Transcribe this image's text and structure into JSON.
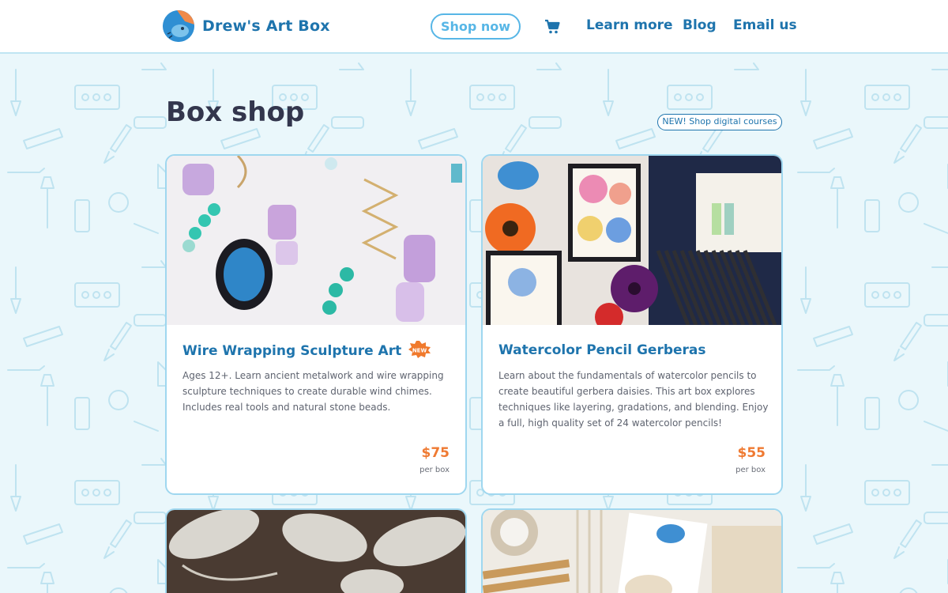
{
  "header": {
    "logo_text": "Drew's Art Box",
    "shop_now": "Shop now",
    "cart_icon": "cart-icon",
    "nav_links": [
      "Learn more",
      "Blog",
      "Email us"
    ]
  },
  "main": {
    "title": "Box shop",
    "digital_link": "NEW! Shop digital courses"
  },
  "cards": [
    {
      "title": "Wire Wrapping Sculpture Art",
      "badge": "NEW",
      "description": "Ages 12+. Learn ancient metalwork and wire wrapping sculpture techniques to create durable wind chimes. Includes real tools and natural stone beads.",
      "price": "$75",
      "per": "per box"
    },
    {
      "title": "Watercolor Pencil Gerberas",
      "description": "Learn about the fundamentals of watercolor pencils to create beautiful gerbera daisies. This art box explores techniques like layering, gradations, and blending. Enjoy a full, high quality set of 24 watercolor pencils!",
      "price": "$55",
      "per": "per box"
    }
  ],
  "colors": {
    "brand_blue": "#1e74ad",
    "accent_light_blue": "#57b6e6",
    "price_orange": "#ef7a32",
    "page_background": "#eaf7fb"
  }
}
